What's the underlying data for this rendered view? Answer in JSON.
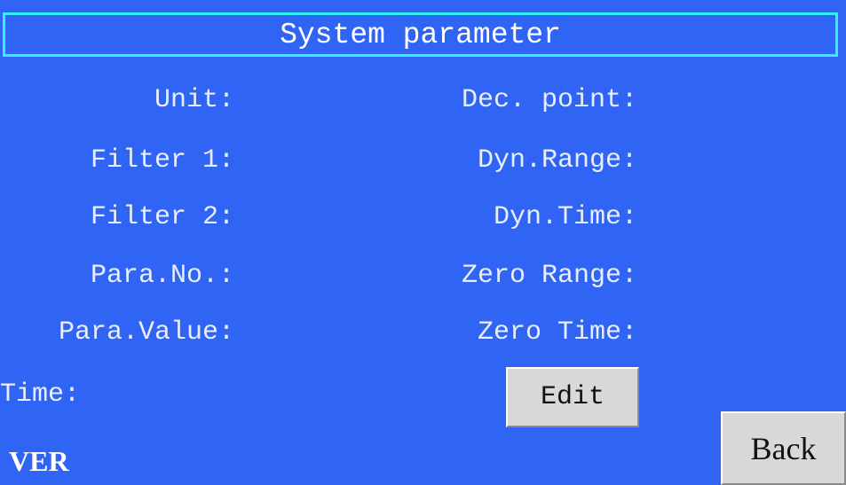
{
  "title": "System parameter",
  "left_labels": {
    "unit": "Unit:",
    "filter1": "Filter 1:",
    "filter2": "Filter 2:",
    "para_no": "Para.No.:",
    "para_value": "Para.Value:",
    "time": "Time:"
  },
  "right_labels": {
    "dec_point": "Dec. point:",
    "dyn_range": "Dyn.Range:",
    "dyn_time": "Dyn.Time:",
    "zero_range": "Zero Range:",
    "zero_time": "Zero Time:"
  },
  "version_label": "VER",
  "buttons": {
    "edit": "Edit",
    "back": "Back"
  },
  "colors": {
    "background": "#2f64f5",
    "title_border": "#2ff2f2",
    "text": "#e8eefc",
    "button_face": "#d8d8d8"
  }
}
